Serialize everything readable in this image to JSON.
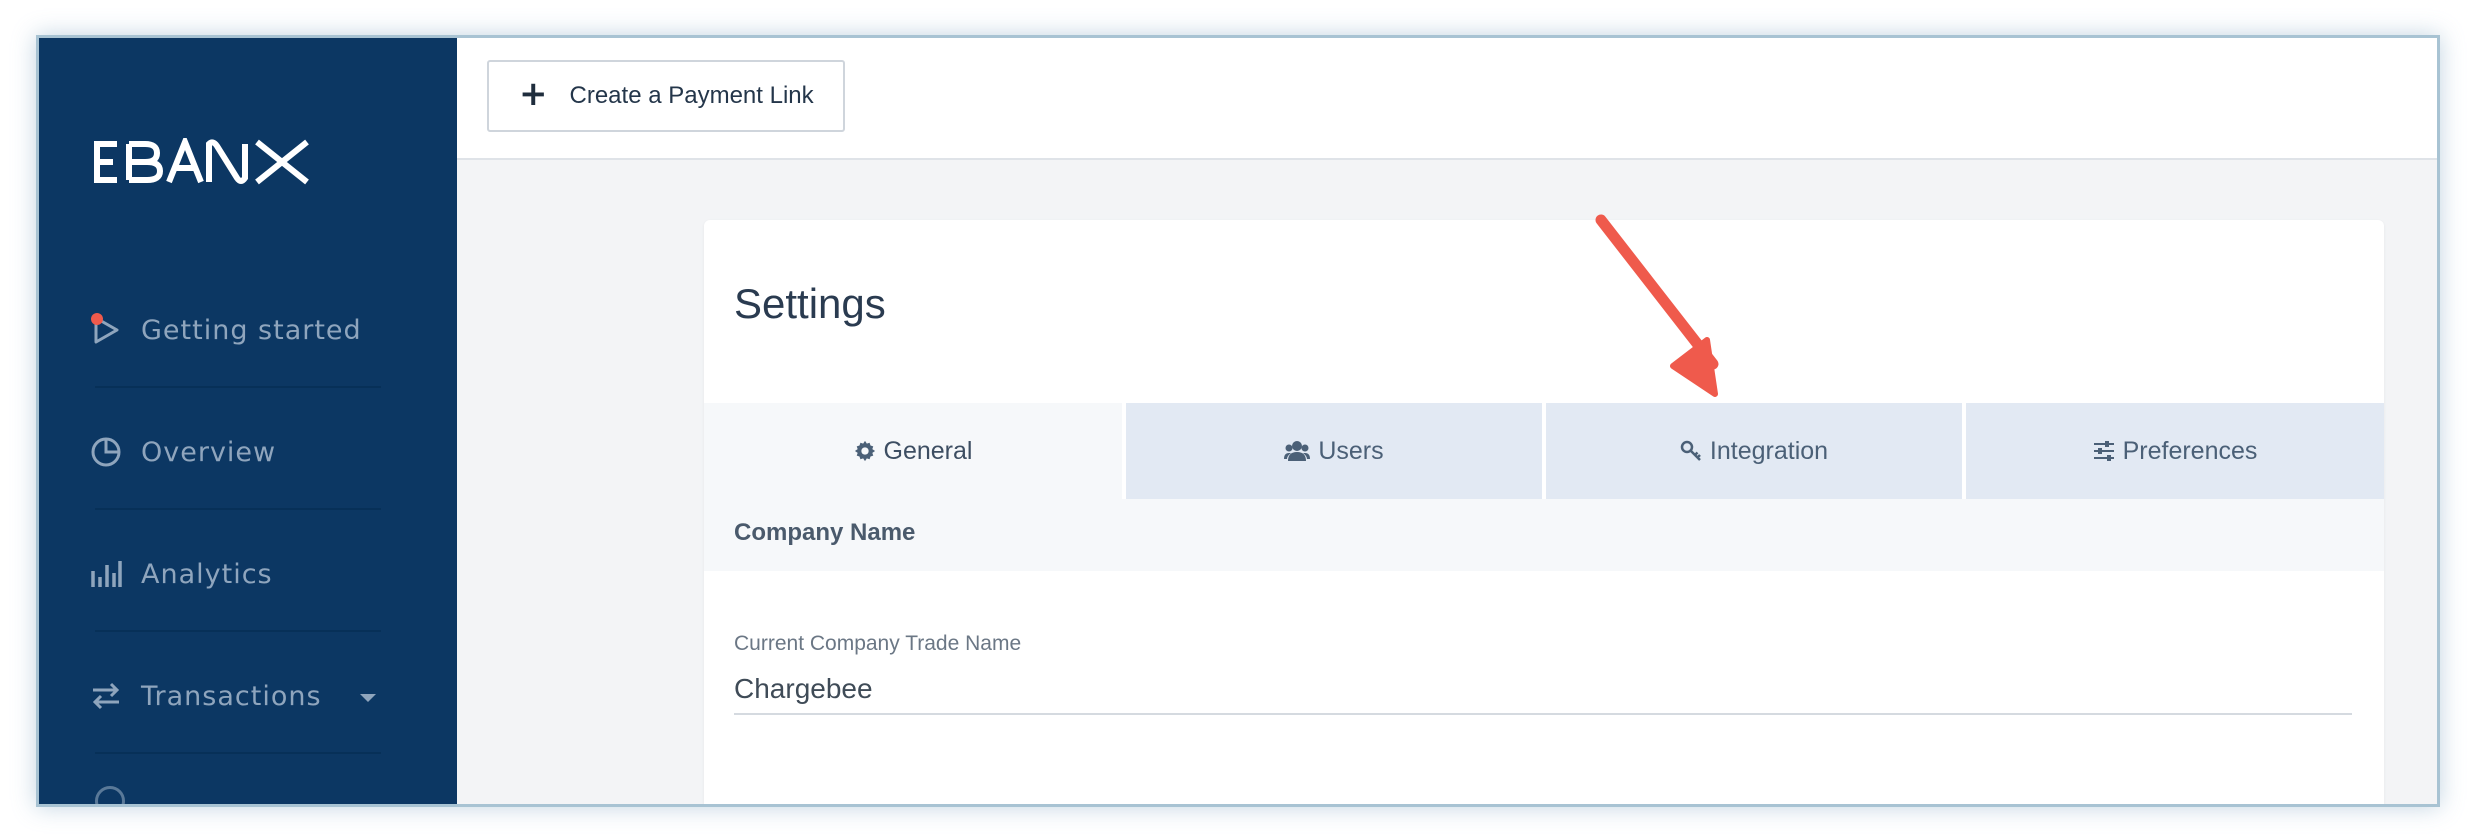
{
  "brand": {
    "logo_text": "EBANX",
    "sidebar_color": "#0c3763"
  },
  "sidebar": {
    "items": [
      {
        "label": "Getting started",
        "icon": "play-icon"
      },
      {
        "label": "Overview",
        "icon": "pie-chart-icon"
      },
      {
        "label": "Analytics",
        "icon": "bar-chart-icon"
      },
      {
        "label": "Transactions",
        "icon": "arrows-swap-icon",
        "has_dropdown": true
      }
    ]
  },
  "topbar": {
    "create_button_label": "Create a Payment Link",
    "create_button_icon": "plus-icon"
  },
  "settings": {
    "title": "Settings",
    "tabs": [
      {
        "label": "General",
        "icon": "gear-icon",
        "active": true
      },
      {
        "label": "Users",
        "icon": "users-icon",
        "active": false
      },
      {
        "label": "Integration",
        "icon": "key-icon",
        "active": false
      },
      {
        "label": "Preferences",
        "icon": "sliders-icon",
        "active": false
      }
    ],
    "section_title": "Company Name",
    "field": {
      "label": "Current Company Trade Name",
      "value": "Chargebee"
    }
  },
  "annotation": {
    "arrow_color": "#ef5a4c"
  }
}
